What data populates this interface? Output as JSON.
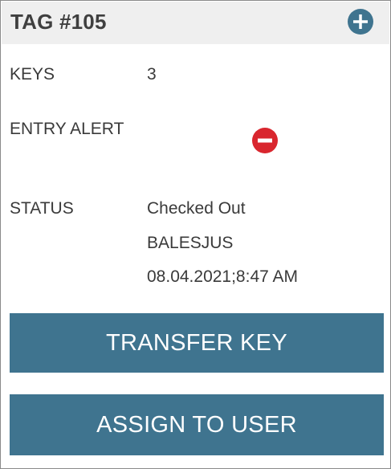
{
  "header": {
    "title": "TAG #105",
    "add_icon": "plus-circle-icon"
  },
  "fields": {
    "keys": {
      "label": "KEYS",
      "value": "3"
    },
    "entry_alert": {
      "label": "ENTRY ALERT",
      "icon": "minus-circle-icon"
    },
    "status": {
      "label": "STATUS",
      "state": "Checked Out",
      "user": "BALESJUS",
      "timestamp": "08.04.2021;8:47 AM"
    }
  },
  "actions": {
    "transfer_label": "TRANSFER KEY",
    "assign_label": "ASSIGN TO USER"
  },
  "colors": {
    "accent": "#3f748f",
    "header_bg": "#efefef",
    "alert": "#d9262e"
  }
}
